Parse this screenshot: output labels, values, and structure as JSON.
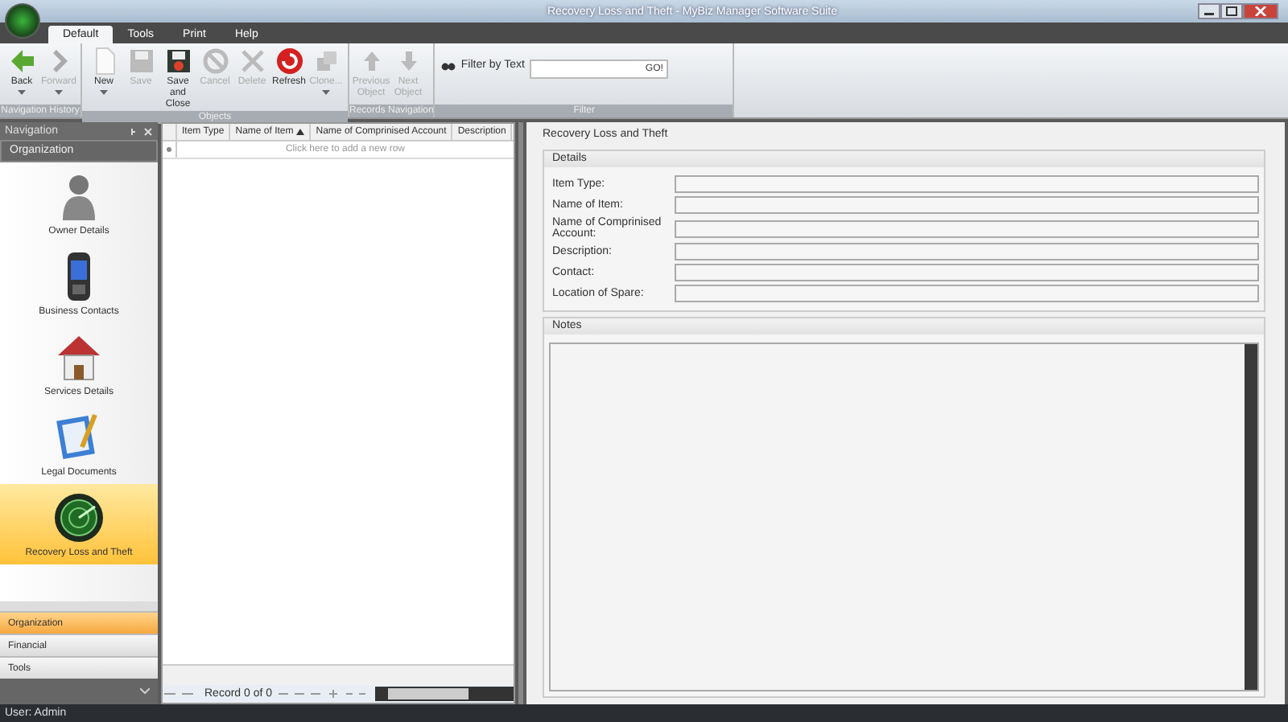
{
  "window": {
    "title": "Recovery Loss and Theft - MyBiz Manager Software Suite"
  },
  "ribbon_tabs": [
    {
      "label": "Default",
      "selected": true
    },
    {
      "label": "Tools",
      "selected": false
    },
    {
      "label": "Print",
      "selected": false
    },
    {
      "label": "Help",
      "selected": false
    }
  ],
  "ribbon_groups": [
    {
      "label": "Navigation History",
      "buttons": [
        {
          "label": "Back",
          "kind": "back",
          "disabled": false,
          "dropdown": true
        },
        {
          "label": "Forward",
          "kind": "forward",
          "disabled": true,
          "dropdown": true
        }
      ]
    },
    {
      "label": "Objects",
      "buttons": [
        {
          "label": "New",
          "kind": "new",
          "disabled": false,
          "dropdown": true
        },
        {
          "label": "Save",
          "kind": "save",
          "disabled": true,
          "dropdown": false
        },
        {
          "label": "Save and Close",
          "kind": "saveclose",
          "disabled": false,
          "dropdown": false
        },
        {
          "label": "Cancel",
          "kind": "cancel",
          "disabled": true,
          "dropdown": false
        },
        {
          "label": "Delete",
          "kind": "delete",
          "disabled": true,
          "dropdown": false
        },
        {
          "label": "Refresh",
          "kind": "refresh",
          "disabled": false,
          "dropdown": false
        },
        {
          "label": "Clone...",
          "kind": "clone",
          "disabled": true,
          "dropdown": true
        }
      ]
    },
    {
      "label": "Records Navigation",
      "buttons": [
        {
          "label": "Previous Object",
          "kind": "previous",
          "disabled": true,
          "dropdown": false
        },
        {
          "label": "Next Object",
          "kind": "next",
          "disabled": true,
          "dropdown": false
        }
      ]
    }
  ],
  "filter": {
    "group_label": "Filter",
    "label": "Filter by Text",
    "button": "GO!"
  },
  "navigation": {
    "title": "Navigation",
    "group_header": "Organization",
    "items": [
      {
        "label": "Owner Details",
        "kind": "person",
        "selected": false
      },
      {
        "label": "Business Contacts",
        "kind": "phone",
        "selected": false
      },
      {
        "label": "Services Details",
        "kind": "house",
        "selected": false
      },
      {
        "label": "Legal Documents",
        "kind": "document",
        "selected": false
      },
      {
        "label": "Recovery Loss and Theft",
        "kind": "radar",
        "selected": true
      }
    ],
    "groups": [
      {
        "label": "Organization",
        "selected": true
      },
      {
        "label": "Financial",
        "selected": false
      },
      {
        "label": "Tools",
        "selected": false
      }
    ]
  },
  "grid": {
    "columns": [
      {
        "label": "Item Type",
        "sorted": false
      },
      {
        "label": "Name of Item",
        "sorted": true
      },
      {
        "label": "Name of Comprinised Account",
        "sorted": false
      },
      {
        "label": "Description",
        "sorted": false
      }
    ],
    "new_row": "Click here to add a new row",
    "record": "Record 0 of 0"
  },
  "detail": {
    "title": "Recovery Loss and Theft",
    "section": "Details",
    "fields": [
      {
        "label": "Item Type:"
      },
      {
        "label": "Name of Item:"
      },
      {
        "label": "Name of Comprinised Account:"
      },
      {
        "label": "Description:"
      },
      {
        "label": "Contact:"
      },
      {
        "label": "Location of Spare:"
      }
    ],
    "notes_label": "Notes"
  },
  "status_bar": "User: Admin"
}
